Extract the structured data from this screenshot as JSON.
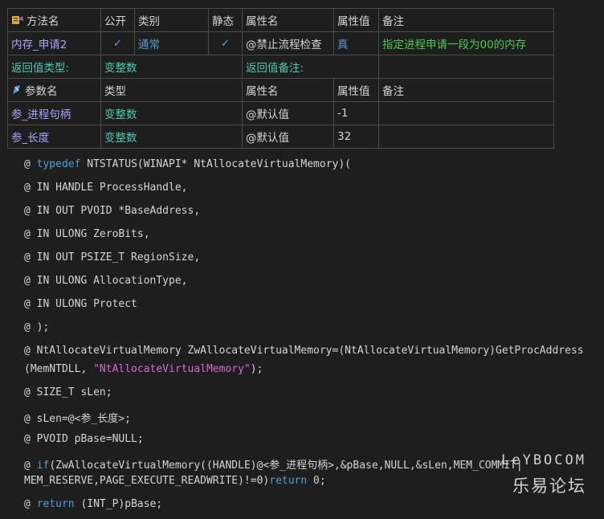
{
  "method_table": {
    "headers": [
      "方法名",
      "公开",
      "类别",
      "静态",
      "属性名",
      "属性值",
      "备注"
    ],
    "row": {
      "name": "内存_申请2",
      "public_check": "✓",
      "category": "通常",
      "static_check": "✓",
      "attr_name": "@禁止流程检查",
      "attr_value": "真",
      "note": "指定进程申请一段为00的内存"
    },
    "return_row": {
      "type_label": "返回值类型:",
      "type_value": "变整数",
      "note_label": "返回值备注:"
    }
  },
  "param_table": {
    "headers": [
      "参数名",
      "类型",
      "属性名",
      "属性值",
      "备注"
    ],
    "rows": [
      {
        "name": "参_进程句柄",
        "type": "变整数",
        "attr_name": "@默认值",
        "attr_value": "-1",
        "note": ""
      },
      {
        "name": "参_长度",
        "type": "变整数",
        "attr_name": "@默认值",
        "attr_value": "32",
        "note": ""
      }
    ]
  },
  "code": {
    "l1": {
      "a": "@ ",
      "b": "typedef",
      "c": " NTSTATUS(WINAPI* NtAllocateVirtualMemory)("
    },
    "l2": "@ IN HANDLE  ProcessHandle,",
    "l3": "@ IN OUT PVOID  *BaseAddress,",
    "l4": "@ IN ULONG  ZeroBits,",
    "l5": "@ IN OUT PSIZE_T  RegionSize,",
    "l6": "@ IN ULONG  AllocationType,",
    "l7": "@ IN ULONG  Protect",
    "l8": "@ );",
    "l9a": "@ NtAllocateVirtualMemory ZwAllocateVirtualMemory=(NtAllocateVirtualMemory)GetProcAddress",
    "l9b": {
      "a": "(MemNTDLL, ",
      "b": "\"NtAllocateVirtualMemory\"",
      "c": ");"
    },
    "l10": "@  SIZE_T sLen;",
    "l11": "@  sLen=@<参_长度>;",
    "l12": "@  PVOID pBase=NULL;",
    "l13a": {
      "a": "@  ",
      "b": "if",
      "c": "(ZwAllocateVirtualMemory((HANDLE)@<参_进程句柄>,&pBase,NULL,&sLen,MEM_COMMIT|"
    },
    "l13b": {
      "a": "MEM_RESERVE,PAGE_EXECUTE_READWRITE)!=0)",
      "b": "return",
      "c": " 0;"
    },
    "l14": {
      "a": "@ ",
      "b": "return",
      "c": " (INT_P)pBase;"
    }
  },
  "watermark": {
    "line1": "LeYBOCOM",
    "line2": "乐易论坛"
  },
  "colors": {
    "background": "#1e1e1e",
    "type": "#4ec9b0",
    "keyword": "#569cd6",
    "note": "#4ec94e",
    "string": "#d16bd1"
  }
}
